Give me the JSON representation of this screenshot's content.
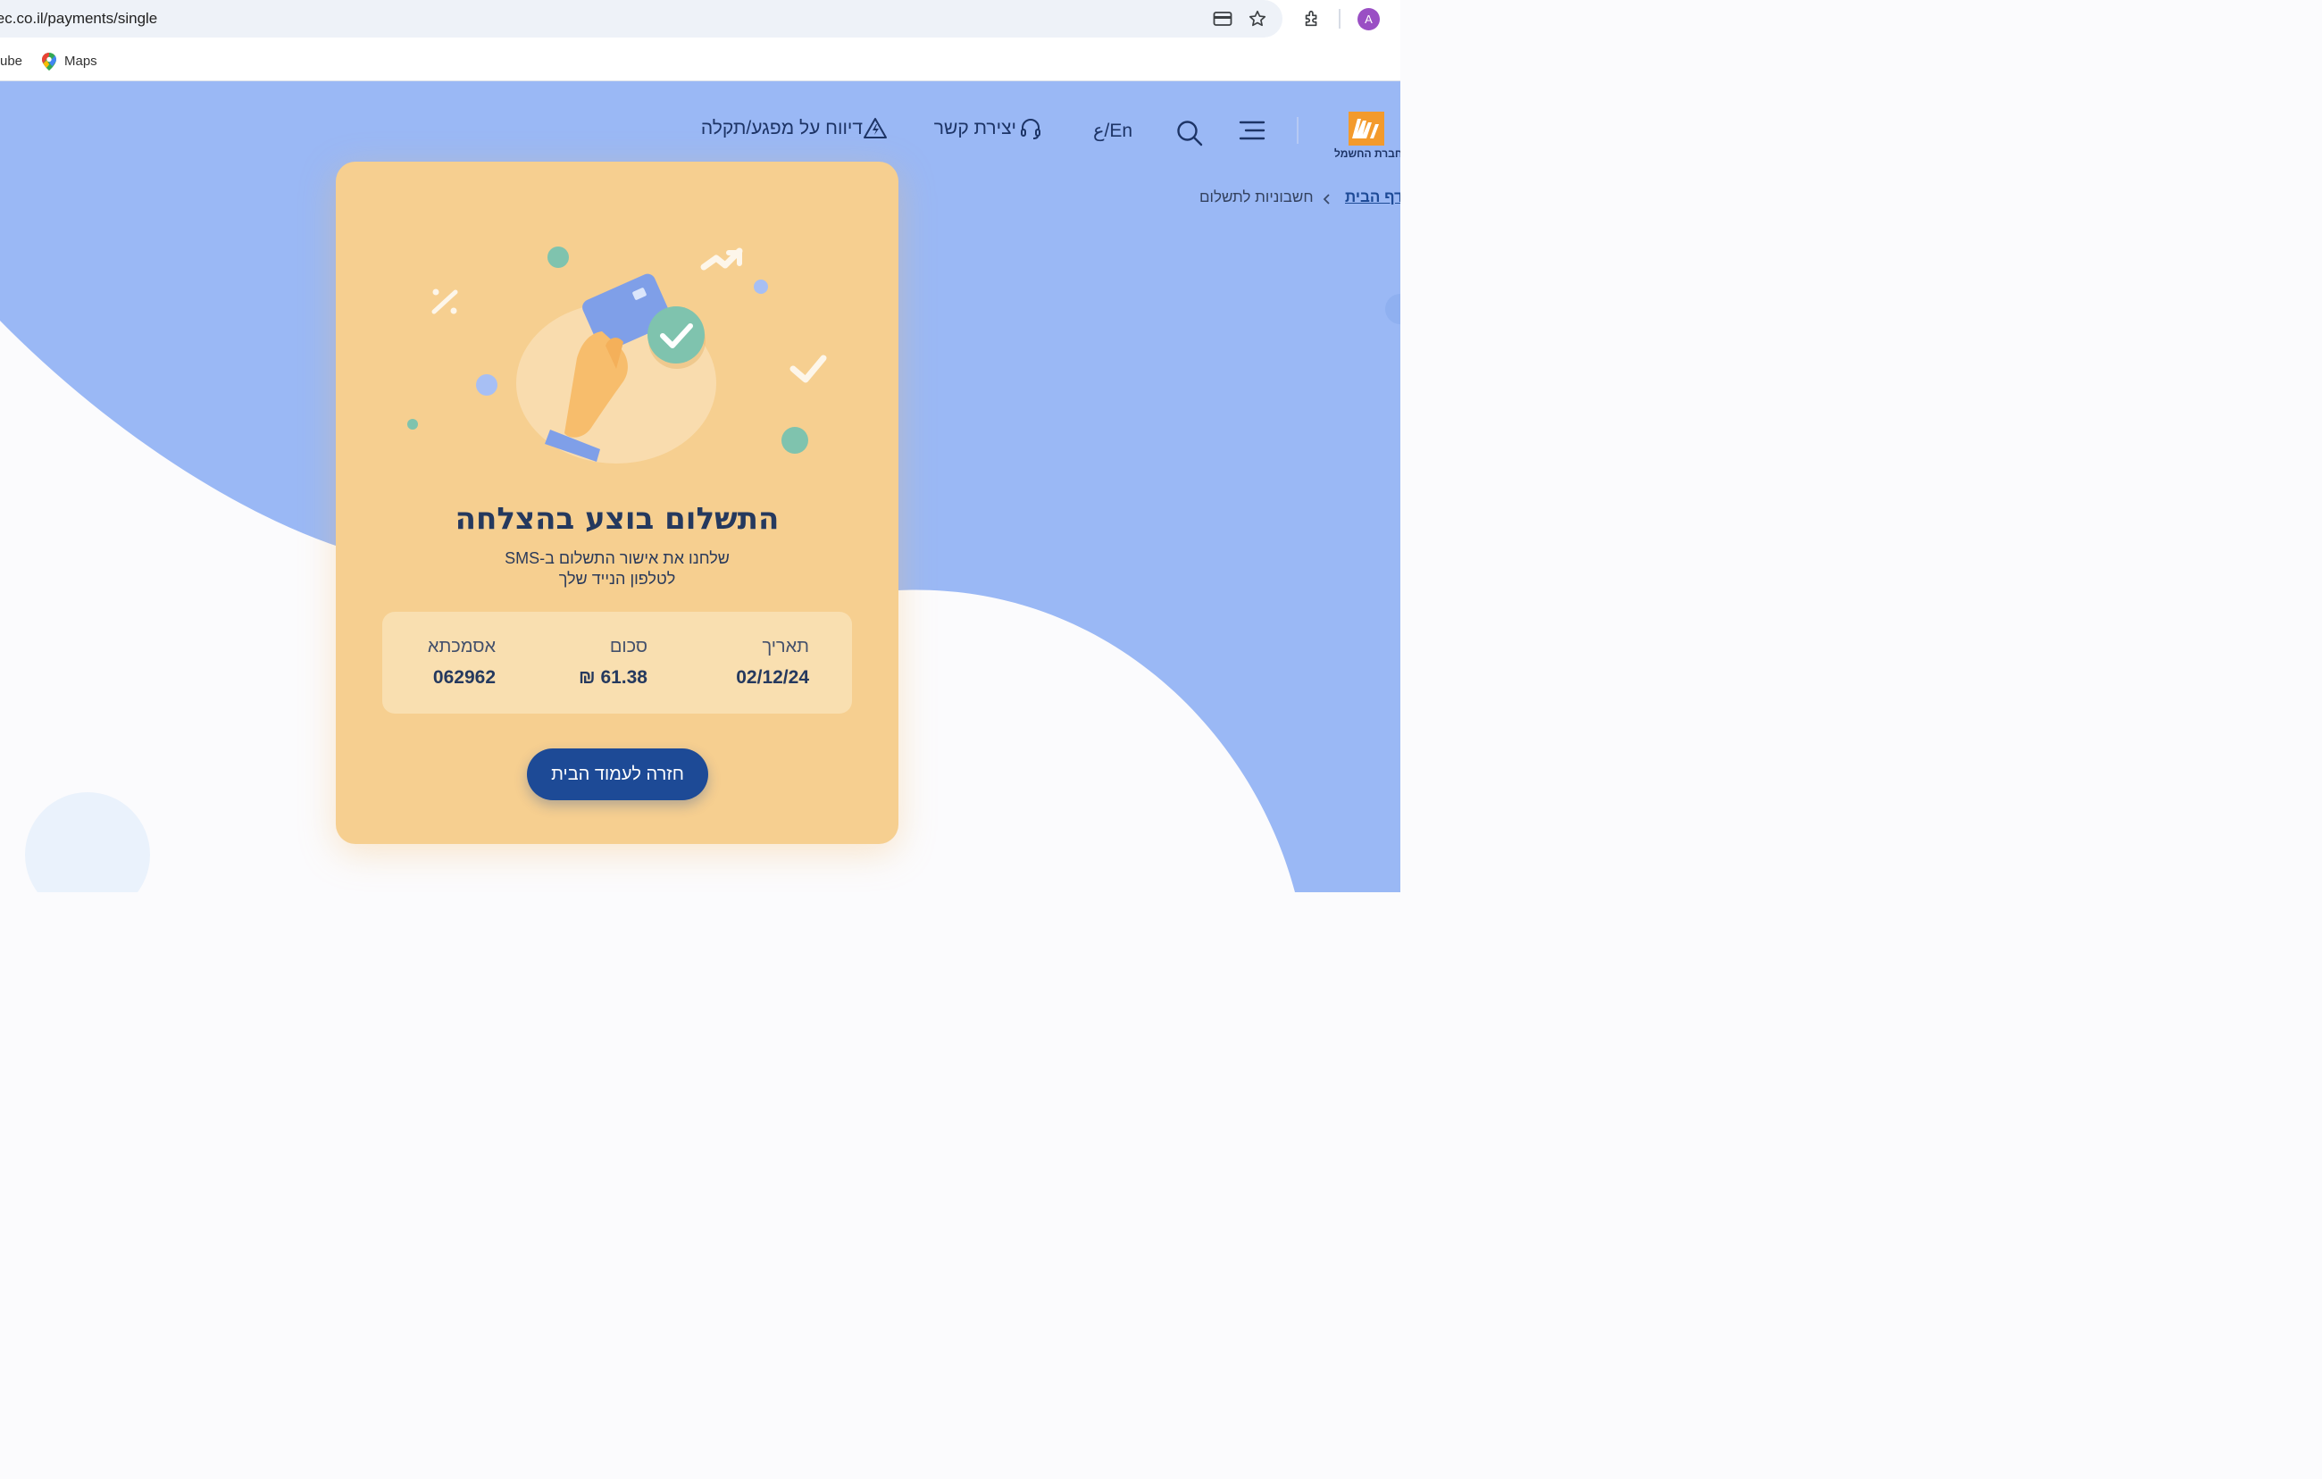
{
  "browser": {
    "url": "iec.co.il/payments/single",
    "bookmarks": [
      "ube",
      "Maps"
    ],
    "profile_initial": "A",
    "icons": [
      "card-icon",
      "star-icon",
      "extensions-icon"
    ]
  },
  "header": {
    "logo_text": "חברת החשמל",
    "language": "En/ع",
    "contact": "יצירת קשר",
    "report": "דיווח על מפגע/תקלה",
    "icons": [
      "menu-icon",
      "search-icon",
      "headset-icon",
      "lightning-warning-icon"
    ]
  },
  "breadcrumb": {
    "home": "דף הבית",
    "current": "חשבוניות לתשלום"
  },
  "card": {
    "title": "התשלום בוצע בהצלחה",
    "subtitle_line1": "שלחנו את אישור התשלום ב-SMS",
    "subtitle_line2": "לטלפון הנייד שלך",
    "details": {
      "date_label": "תאריך",
      "date_value": "02/12/24",
      "amount_label": "סכום",
      "amount_value": "61.38 ₪",
      "reference_label": "אסמכתא",
      "reference_value": "062962"
    },
    "button_label": "חזרה לעמוד הבית"
  },
  "colors": {
    "page_bg": "#9ab8f5",
    "card_bg": "#f6cf90",
    "info_bg": "#f9dfb0",
    "button_bg": "#1d4a96",
    "logo_orange": "#f39a2c",
    "heading": "#25395e"
  }
}
